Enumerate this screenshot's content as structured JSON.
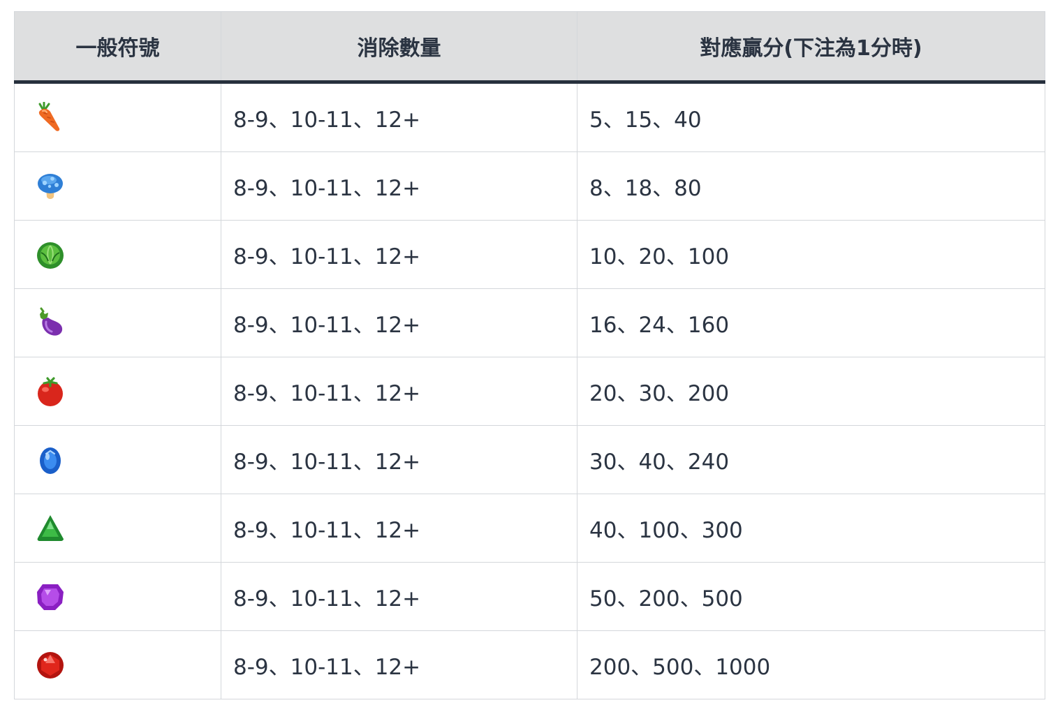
{
  "table": {
    "headers": {
      "symbol": "一般符號",
      "count": "消除數量",
      "payout": "對應贏分(下注為1分時)"
    },
    "rows": [
      {
        "icon": "carrot-icon",
        "count": "8-9、10-11、12+",
        "payout": "5、15、40"
      },
      {
        "icon": "mushroom-icon",
        "count": "8-9、10-11、12+",
        "payout": "8、18、80"
      },
      {
        "icon": "cabbage-icon",
        "count": "8-9、10-11、12+",
        "payout": "10、20、100"
      },
      {
        "icon": "eggplant-icon",
        "count": "8-9、10-11、12+",
        "payout": "16、24、160"
      },
      {
        "icon": "tomato-icon",
        "count": "8-9、10-11、12+",
        "payout": "20、30、200"
      },
      {
        "icon": "blue-gem-icon",
        "count": "8-9、10-11、12+",
        "payout": "30、40、240"
      },
      {
        "icon": "green-gem-icon",
        "count": "8-9、10-11、12+",
        "payout": "40、100、300"
      },
      {
        "icon": "purple-gem-icon",
        "count": "8-9、10-11、12+",
        "payout": "50、200、500"
      },
      {
        "icon": "red-gem-icon",
        "count": "8-9、10-11、12+",
        "payout": "200、500、1000"
      }
    ]
  },
  "colors": {
    "header_bg": "#dedfe0",
    "header_rule": "#27303d",
    "text": "#2b3442",
    "border": "#d4d7db"
  }
}
